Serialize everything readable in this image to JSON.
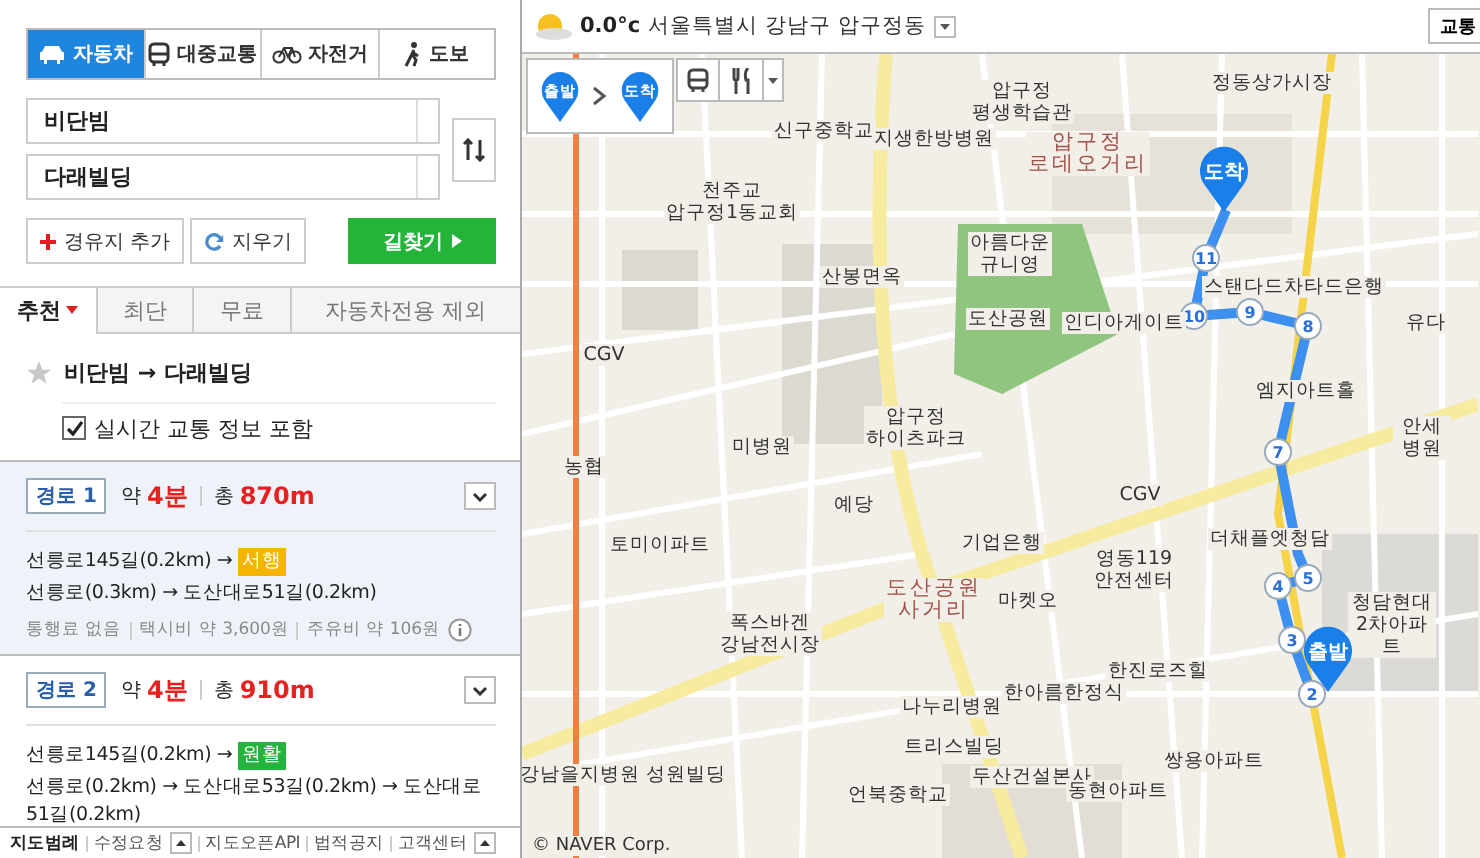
{
  "transport_tabs": [
    {
      "label": "자동차",
      "kind": "car",
      "selected": true
    },
    {
      "label": "대중교통",
      "kind": "bus",
      "selected": false
    },
    {
      "label": "자전거",
      "kind": "bike",
      "selected": false
    },
    {
      "label": "도보",
      "kind": "walk",
      "selected": false
    }
  ],
  "origin": {
    "value": "비단빔"
  },
  "destination": {
    "value": "다래빌딩"
  },
  "buttons": {
    "add_waypoint": "경유지 추가",
    "clear": "지우기",
    "search": "길찾기"
  },
  "option_tabs": [
    {
      "label": "추천",
      "selected": true
    },
    {
      "label": "최단",
      "selected": false
    },
    {
      "label": "무료",
      "selected": false
    },
    {
      "label": "자동차전용 제외",
      "selected": false
    }
  ],
  "favorite": {
    "text": "비단빔 → 다래빌딩",
    "starred": false
  },
  "realtime_traffic": {
    "label": "실시간 교통 정보 포함",
    "checked": true
  },
  "routes": [
    {
      "badge": "경로 1",
      "selected": true,
      "time_prefix": "약",
      "time": "4분",
      "distance_prefix": "총",
      "distance": "870m",
      "parts": [
        {
          "kind": "text",
          "text": "선릉로145길(0.2km) →"
        },
        {
          "kind": "tag",
          "text": "서행",
          "color": "#f5b400"
        },
        {
          "kind": "text",
          "text": "선릉로(0.3km) → 도산대로51길(0.2km)"
        }
      ],
      "info": [
        "통행료 없음",
        "택시비 약 3,600원",
        "주유비 약 106원"
      ]
    },
    {
      "badge": "경로 2",
      "selected": false,
      "time_prefix": "약",
      "time": "4분",
      "distance_prefix": "총",
      "distance": "910m",
      "parts": [
        {
          "kind": "text",
          "text": "선릉로145길(0.2km) →"
        },
        {
          "kind": "tag",
          "text": "원활",
          "color": "#22b43c"
        },
        {
          "kind": "text",
          "text": "선릉로(0.2km) → 도산대로53길(0.2km) → 도산대로51길(0.2km)"
        }
      ]
    }
  ],
  "footer": [
    {
      "label": "지도범례",
      "bold": true,
      "menu": false
    },
    {
      "label": "수정요청",
      "bold": false,
      "menu": true
    },
    {
      "label": "지도오픈API",
      "bold": false,
      "menu": false
    },
    {
      "label": "법적공지",
      "bold": false,
      "menu": false
    },
    {
      "label": "고객센터",
      "bold": false,
      "menu": true
    }
  ],
  "map": {
    "weather": {
      "temperature": "0.0°c",
      "location": "서울특별시 강남구 압구정동"
    },
    "traffic_button": "교통",
    "route_pins": {
      "start": "출발",
      "end": "도착"
    },
    "panel_pins": {
      "start": "출발",
      "end": "도착"
    },
    "waypoints": [
      "2",
      "3",
      "4",
      "5",
      "7",
      "8",
      "9",
      "10",
      "11"
    ],
    "labels": [
      {
        "text": "압구정\n평생학습관",
        "kind": "place"
      },
      {
        "text": "정동상가시장",
        "kind": "place"
      },
      {
        "text": "신구중학교",
        "kind": "place"
      },
      {
        "text": "지생한방병원",
        "kind": "place"
      },
      {
        "text": "압구정\n로데오거리",
        "kind": "district"
      },
      {
        "text": "천주교\n압구정1동교회",
        "kind": "place"
      },
      {
        "text": "아름다운\n규니영",
        "kind": "place"
      },
      {
        "text": "산봉면옥",
        "kind": "place"
      },
      {
        "text": "도산공원",
        "kind": "place"
      },
      {
        "text": "인디아게이트",
        "kind": "place"
      },
      {
        "text": "스탠다드차타드은행",
        "kind": "place"
      },
      {
        "text": "유다",
        "kind": "place"
      },
      {
        "text": "CGV",
        "kind": "place"
      },
      {
        "text": "미병원",
        "kind": "place"
      },
      {
        "text": "압구정\n하이츠파크",
        "kind": "place"
      },
      {
        "text": "엠지아트홀",
        "kind": "place"
      },
      {
        "text": "안세병원",
        "kind": "place"
      },
      {
        "text": "농협",
        "kind": "place"
      },
      {
        "text": "예당",
        "kind": "place"
      },
      {
        "text": "CGV",
        "kind": "place"
      },
      {
        "text": "토미이파트",
        "kind": "place"
      },
      {
        "text": "기업은행",
        "kind": "place"
      },
      {
        "text": "영동119\n안전센터",
        "kind": "place"
      },
      {
        "text": "더채플엣청담",
        "kind": "place"
      },
      {
        "text": "도산공원\n사거리",
        "kind": "district"
      },
      {
        "text": "마켓오",
        "kind": "place"
      },
      {
        "text": "폭스바겐\n강남전시장",
        "kind": "place"
      },
      {
        "text": "청담현대\n2차아파트",
        "kind": "place"
      },
      {
        "text": "한진로즈힐",
        "kind": "place"
      },
      {
        "text": "한아름한정식",
        "kind": "place"
      },
      {
        "text": "나누리병원",
        "kind": "place"
      },
      {
        "text": "트리스빌딩",
        "kind": "place"
      },
      {
        "text": "쌍용아파트",
        "kind": "place"
      },
      {
        "text": "강남을지병원",
        "kind": "place"
      },
      {
        "text": "성원빌딩",
        "kind": "place"
      },
      {
        "text": "두산건설본사",
        "kind": "place"
      },
      {
        "text": "동현아파트",
        "kind": "place"
      },
      {
        "text": "언북중학교",
        "kind": "place"
      }
    ],
    "copyright": "© NAVER Corp."
  }
}
